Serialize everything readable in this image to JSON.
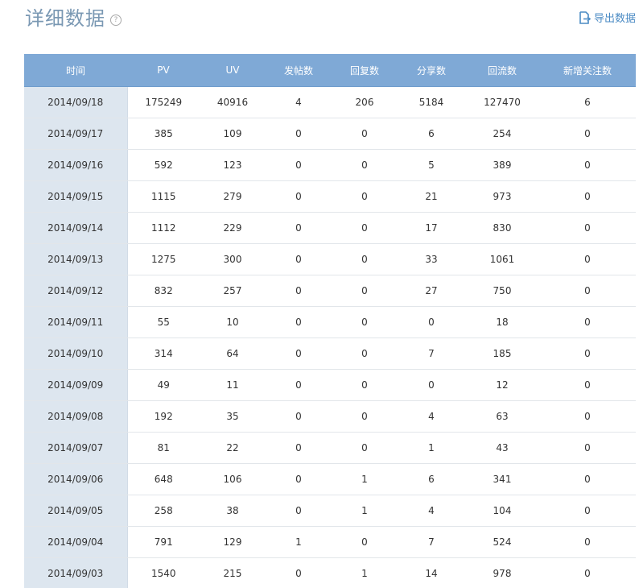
{
  "header": {
    "title": "详细数据",
    "help_icon": "question-circle-icon",
    "export_label": "导出数据",
    "export_icon": "export-file-icon"
  },
  "colors": {
    "title": "#7a98b3",
    "table_header_bg": "#7fa9d6",
    "date_column_bg": "#dde6ef",
    "link": "#4b8bc4"
  },
  "table": {
    "columns": [
      "时间",
      "PV",
      "UV",
      "发帖数",
      "回复数",
      "分享数",
      "回流数",
      "新增关注数"
    ],
    "rows": [
      [
        "2014/09/18",
        "175249",
        "40916",
        "4",
        "206",
        "5184",
        "127470",
        "6"
      ],
      [
        "2014/09/17",
        "385",
        "109",
        "0",
        "0",
        "6",
        "254",
        "0"
      ],
      [
        "2014/09/16",
        "592",
        "123",
        "0",
        "0",
        "5",
        "389",
        "0"
      ],
      [
        "2014/09/15",
        "1115",
        "279",
        "0",
        "0",
        "21",
        "973",
        "0"
      ],
      [
        "2014/09/14",
        "1112",
        "229",
        "0",
        "0",
        "17",
        "830",
        "0"
      ],
      [
        "2014/09/13",
        "1275",
        "300",
        "0",
        "0",
        "33",
        "1061",
        "0"
      ],
      [
        "2014/09/12",
        "832",
        "257",
        "0",
        "0",
        "27",
        "750",
        "0"
      ],
      [
        "2014/09/11",
        "55",
        "10",
        "0",
        "0",
        "0",
        "18",
        "0"
      ],
      [
        "2014/09/10",
        "314",
        "64",
        "0",
        "0",
        "7",
        "185",
        "0"
      ],
      [
        "2014/09/09",
        "49",
        "11",
        "0",
        "0",
        "0",
        "12",
        "0"
      ],
      [
        "2014/09/08",
        "192",
        "35",
        "0",
        "0",
        "4",
        "63",
        "0"
      ],
      [
        "2014/09/07",
        "81",
        "22",
        "0",
        "0",
        "1",
        "43",
        "0"
      ],
      [
        "2014/09/06",
        "648",
        "106",
        "0",
        "1",
        "6",
        "341",
        "0"
      ],
      [
        "2014/09/05",
        "258",
        "38",
        "0",
        "1",
        "4",
        "104",
        "0"
      ],
      [
        "2014/09/04",
        "791",
        "129",
        "1",
        "0",
        "7",
        "524",
        "0"
      ],
      [
        "2014/09/03",
        "1540",
        "215",
        "0",
        "1",
        "14",
        "978",
        "0"
      ]
    ]
  }
}
